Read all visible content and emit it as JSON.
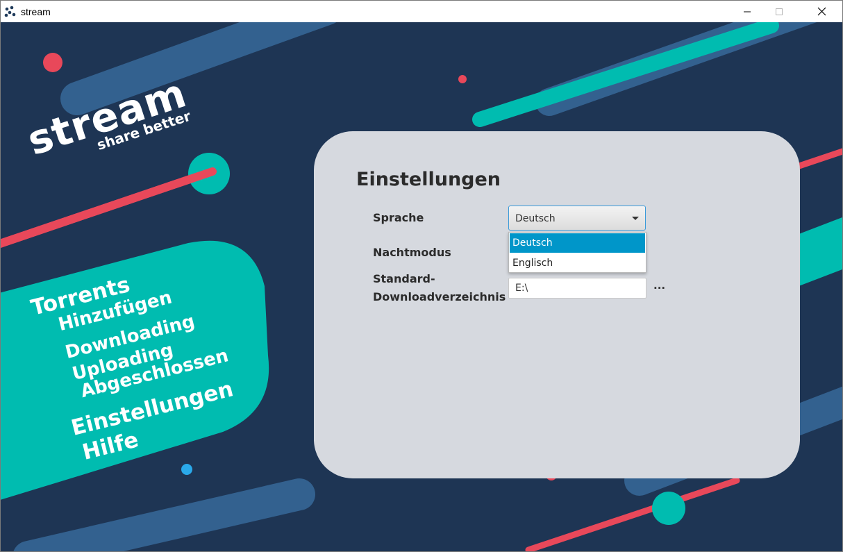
{
  "window": {
    "title": "stream",
    "minimize_icon": "minimize-icon",
    "maximize_icon": "maximize-icon",
    "close_icon": "close-icon"
  },
  "logo": {
    "title": "stream",
    "tagline": "share better"
  },
  "nav": {
    "items": [
      {
        "label": "Torrents"
      },
      {
        "label": "Hinzufügen"
      },
      {
        "label": "Downloading"
      },
      {
        "label": "Uploading"
      },
      {
        "label": "Abgeschlossen"
      },
      {
        "label": "Einstellungen"
      },
      {
        "label": "Hilfe"
      }
    ]
  },
  "settings": {
    "title": "Einstellungen",
    "language_label": "Sprache",
    "language_value": "Deutsch",
    "language_options": [
      "Deutsch",
      "Englisch"
    ],
    "night_mode_label": "Nachtmodus",
    "download_dir_label_line1": "Standard-",
    "download_dir_label_line2": "Downloadverzeichnis",
    "download_dir_value": "E:\\",
    "browse_label": "..."
  },
  "colors": {
    "background": "#1e3554",
    "teal": "#00bcb0",
    "red": "#e8485a",
    "blue": "#3a6a9c",
    "panel": "#d6d9df",
    "accent": "#0096c9"
  }
}
